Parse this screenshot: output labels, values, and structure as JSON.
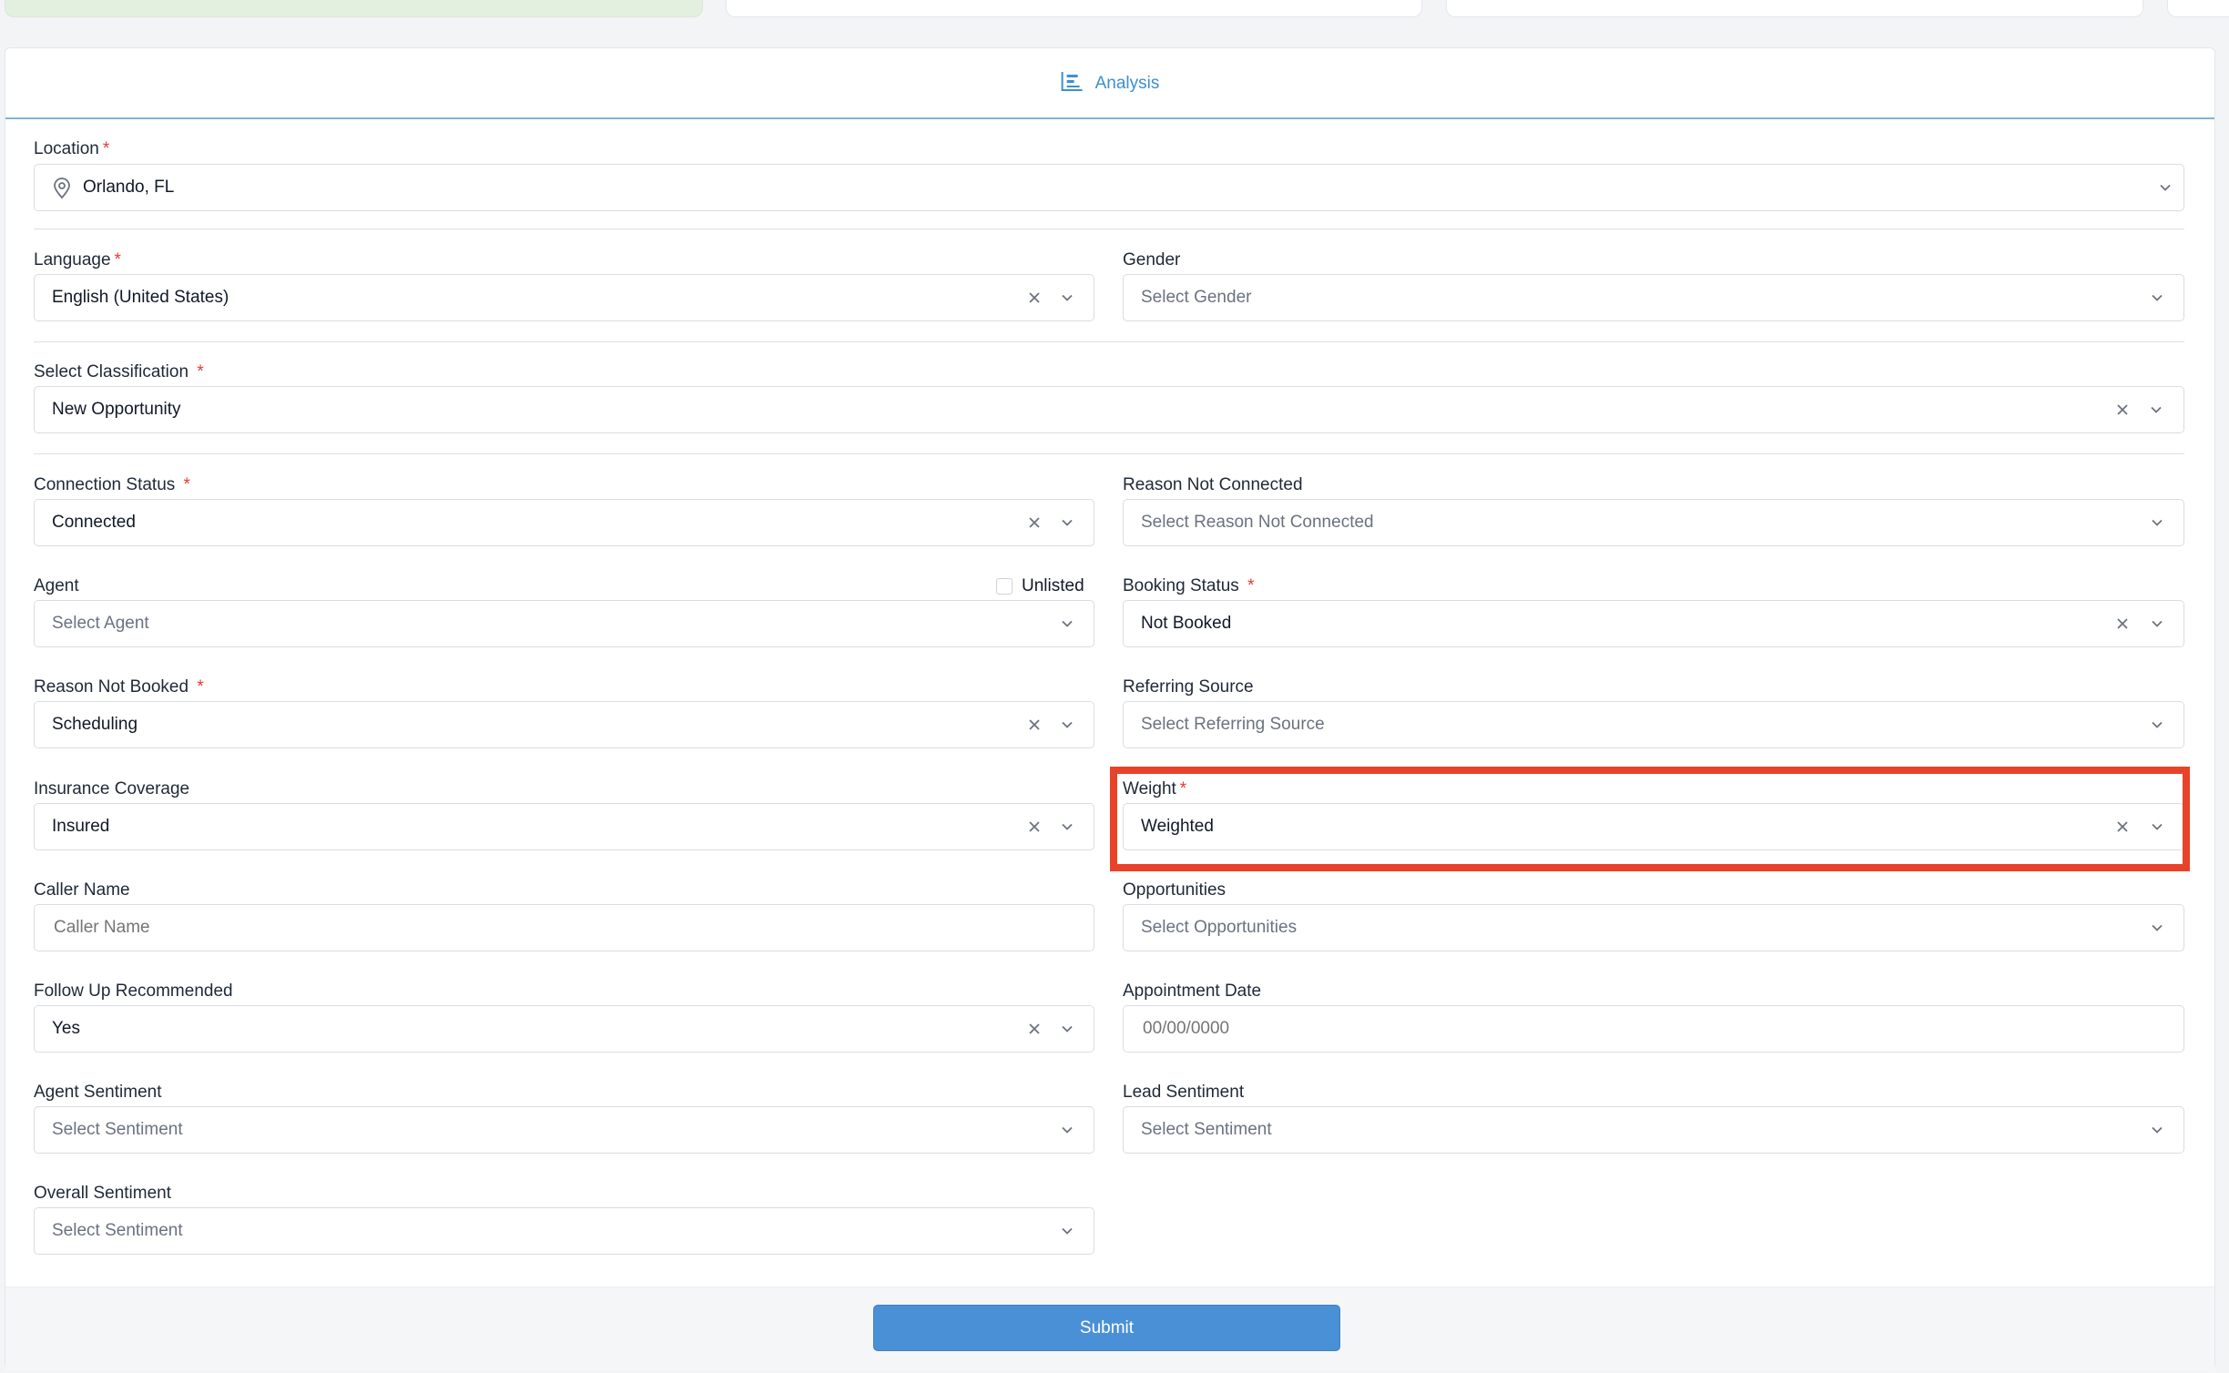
{
  "tab": {
    "label": "Analysis"
  },
  "fields": {
    "location": {
      "label": "Location",
      "value": "Orlando, FL"
    },
    "language": {
      "label": "Language",
      "value": "English (United States)"
    },
    "gender": {
      "label": "Gender",
      "placeholder": "Select Gender"
    },
    "classification": {
      "label": "Select Classification",
      "value": "New Opportunity"
    },
    "connection_status": {
      "label": "Connection Status",
      "value": "Connected"
    },
    "reason_not_connected": {
      "label": "Reason Not Connected",
      "placeholder": "Select Reason Not Connected"
    },
    "agent": {
      "label": "Agent",
      "placeholder": "Select Agent",
      "unlisted_label": "Unlisted"
    },
    "booking_status": {
      "label": "Booking Status",
      "value": "Not Booked"
    },
    "reason_not_booked": {
      "label": "Reason Not Booked",
      "value": "Scheduling"
    },
    "referring_source": {
      "label": "Referring Source",
      "placeholder": "Select Referring Source"
    },
    "insurance_coverage": {
      "label": "Insurance Coverage",
      "value": "Insured"
    },
    "weight": {
      "label": "Weight",
      "value": "Weighted"
    },
    "caller_name": {
      "label": "Caller Name",
      "placeholder": "Caller Name"
    },
    "opportunities": {
      "label": "Opportunities",
      "placeholder": "Select Opportunities"
    },
    "follow_up": {
      "label": "Follow Up Recommended",
      "value": "Yes"
    },
    "appointment_date": {
      "label": "Appointment Date",
      "placeholder": "00/00/0000"
    },
    "agent_sentiment": {
      "label": "Agent Sentiment",
      "placeholder": "Select Sentiment"
    },
    "lead_sentiment": {
      "label": "Lead Sentiment",
      "placeholder": "Select Sentiment"
    },
    "overall_sentiment": {
      "label": "Overall Sentiment",
      "placeholder": "Select Sentiment"
    }
  },
  "required_mark": "*",
  "submit_label": "Submit",
  "colors": {
    "accent": "#3d8fd1",
    "required": "#e53935",
    "highlight": "#e8432a",
    "submit": "#4a90d6"
  }
}
